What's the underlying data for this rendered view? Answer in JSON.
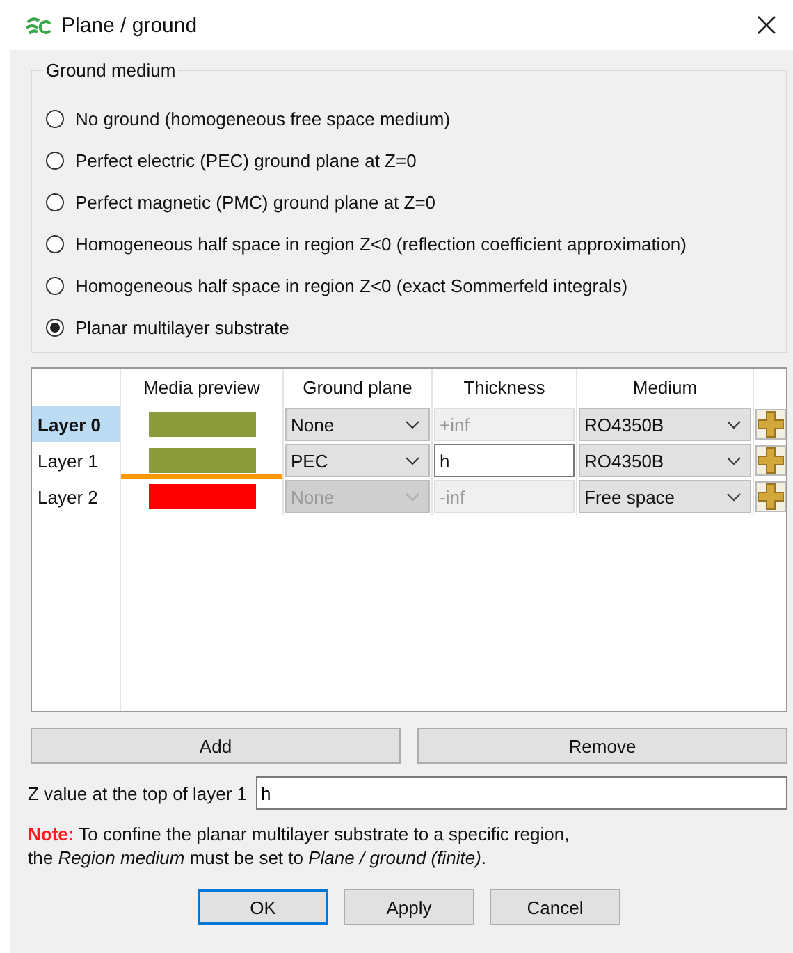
{
  "window": {
    "title": "Plane / ground"
  },
  "ground_medium": {
    "title": "Ground medium",
    "options": [
      {
        "label": "No ground (homogeneous free space medium)",
        "selected": false
      },
      {
        "label": "Perfect electric (PEC) ground plane at Z=0",
        "selected": false
      },
      {
        "label": "Perfect magnetic (PMC) ground plane at Z=0",
        "selected": false
      },
      {
        "label": "Homogeneous half space in region Z<0 (reflection coefficient approximation)",
        "selected": false
      },
      {
        "label": "Homogeneous half space in region Z<0 (exact Sommerfeld integrals)",
        "selected": false
      },
      {
        "label": "Planar multilayer substrate",
        "selected": true
      }
    ]
  },
  "table": {
    "columns": [
      "Media preview",
      "Ground plane",
      "Thickness",
      "Medium"
    ],
    "rows": [
      {
        "name": "Layer 0",
        "selected": true,
        "color": "#8c9c3c",
        "ground_line": false,
        "ground_plane": "None",
        "ground_disabled": false,
        "thickness": "+inf",
        "thickness_editable": false,
        "medium": "RO4350B"
      },
      {
        "name": "Layer 1",
        "selected": false,
        "color": "#8c9c3c",
        "ground_line": true,
        "ground_plane": "PEC",
        "ground_disabled": false,
        "thickness": "h",
        "thickness_editable": true,
        "medium": "RO4350B"
      },
      {
        "name": "Layer 2",
        "selected": false,
        "color": "#ff0000",
        "ground_line": false,
        "ground_plane": "None",
        "ground_disabled": true,
        "thickness": "-inf",
        "thickness_editable": false,
        "medium": "Free space"
      }
    ]
  },
  "buttons": [
    "Add",
    "Remove"
  ],
  "z_value": {
    "label": "Z value at the top of layer 1",
    "value": "h"
  },
  "note": "**Note:** To confine the planar multilayer substrate to a specific region,\nthe *Region medium* must be set to *Plane / ground (finite)*.",
  "dialog_buttons": [
    {
      "label": "OK",
      "default": true
    },
    {
      "label": "Apply",
      "default": false
    },
    {
      "label": "Cancel",
      "default": false
    }
  ]
}
